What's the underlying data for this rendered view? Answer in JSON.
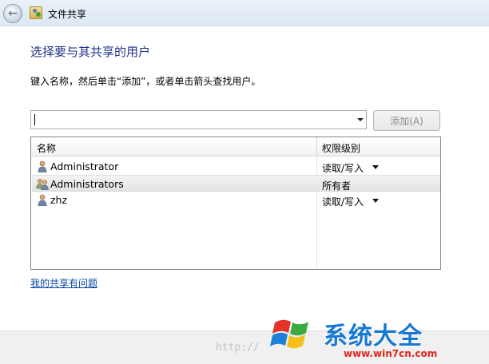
{
  "window": {
    "title": "文件共享"
  },
  "heading": "选择要与其共享的用户",
  "instruction": "键入名称，然后单击“添加”，或者单击箭头查找用户。",
  "input": {
    "value": ""
  },
  "add_button": {
    "label": "添加(A)"
  },
  "table": {
    "columns": [
      "名称",
      "权限级别"
    ],
    "rows": [
      {
        "name": "Administrator",
        "permission": "读取/写入",
        "has_dropdown": true,
        "icon": "user-icon"
      },
      {
        "name": "Administrators",
        "permission": "所有者",
        "has_dropdown": false,
        "icon": "user-group-icon"
      },
      {
        "name": "zhz",
        "permission": "读取/写入",
        "has_dropdown": true,
        "icon": "user-icon"
      }
    ]
  },
  "help_link": "我的共享有问题",
  "watermark": {
    "url": "http://",
    "brand": "系统大全",
    "site": "www.win7cn.com"
  },
  "colors": {
    "heading": "#1e3287",
    "link": "#0b47a8",
    "brand": "#1678d3",
    "site": "#e0231c"
  }
}
